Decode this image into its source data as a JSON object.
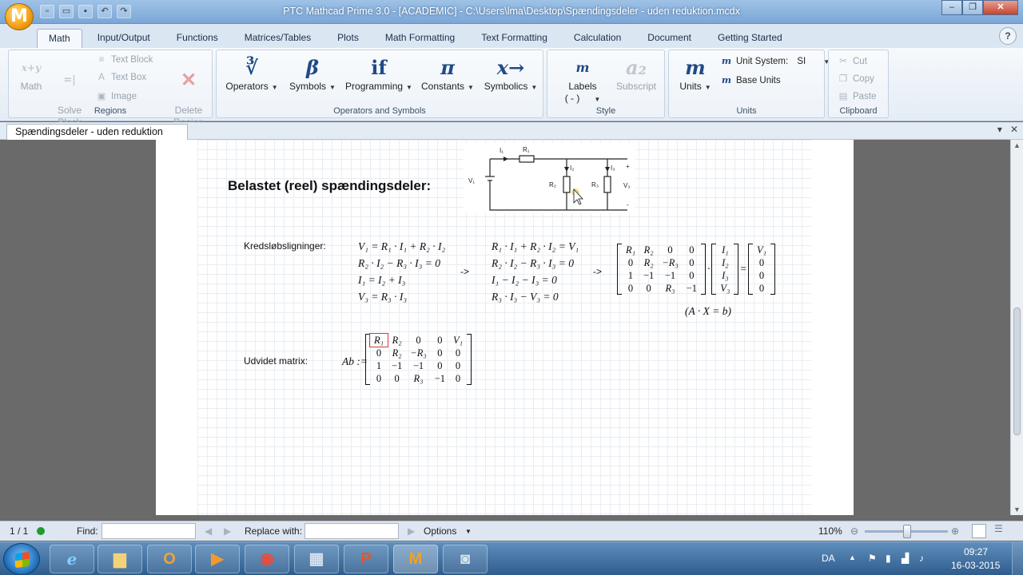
{
  "window": {
    "title": "PTC Mathcad Prime 3.0 - [ACADEMIC] - C:\\Users\\lma\\Desktop\\Spændingsdeler - uden reduktion.mcdx",
    "logo_letter": "M"
  },
  "ribbon_tabs": [
    "Math",
    "Input/Output",
    "Functions",
    "Matrices/Tables",
    "Plots",
    "Math Formatting",
    "Text Formatting",
    "Calculation",
    "Document",
    "Getting Started"
  ],
  "help": "?",
  "ribbon": {
    "regions": {
      "label": "Regions",
      "math": "Math",
      "solve_block": "Solve\nBlock",
      "text_block": "Text Block",
      "text_box": "Text Box",
      "image": "Image",
      "delete_region": "Delete\nRegion",
      "math_glyph": "x+y",
      "solve_glyph": "=|"
    },
    "operators_symbols": {
      "label": "Operators and Symbols",
      "operators": "Operators",
      "operators_glyph": "∛",
      "symbols": "Symbols",
      "symbols_glyph": "β",
      "programming": "Programming",
      "programming_glyph": "if",
      "constants": "Constants",
      "constants_glyph": "π",
      "symbolics": "Symbolics",
      "symbolics_glyph": "x→"
    },
    "style": {
      "label": "Style",
      "labels": "Labels",
      "labels_value": "( - )",
      "labels_glyph": "m",
      "subscript": "Subscript",
      "subscript_glyph": "a₂"
    },
    "units": {
      "label": "Units",
      "units": "Units",
      "units_glyph": "m",
      "unit_system_label": "Unit System:",
      "unit_system_value": "SI",
      "base_units": "Base Units"
    },
    "clipboard": {
      "label": "Clipboard",
      "cut": "Cut",
      "copy": "Copy",
      "paste": "Paste"
    }
  },
  "document_tab": "Spændingsdeler - uden reduktion",
  "worksheet": {
    "heading": "Belastet (reel) spændingsdeler:",
    "circuit_labels": {
      "I1": "I₁",
      "R1": "R₁",
      "I2": "I₂",
      "I3": "I₃",
      "R2": "R₂",
      "R3": "R₃",
      "V1": "V₁",
      "V3": "V₃",
      "plus": "+",
      "minus": "-"
    },
    "kreds_label": "Kredsløbsligninger:",
    "equations_1": [
      "V₁ = R₁ · I₁ + R₂ · I₂",
      "R₂ · I₂ − R₃ · I₃ = 0",
      "I₁ = I₂ + I₃",
      "V₃ = R₃ · I₃"
    ],
    "arrow1": "->",
    "equations_2": [
      "R₁ · I₁ + R₂ · I₂ = V₁",
      "R₂ · I₂ − R₃ · I₃ = 0",
      "I₁ − I₂ − I₃ = 0",
      "R₃ · I₃ − V₃ = 0"
    ],
    "arrow2": "->",
    "matrix_A": [
      [
        "R₁",
        "R₂",
        "0",
        "0"
      ],
      [
        "0",
        "R₂",
        "−R₃",
        "0"
      ],
      [
        "1",
        "−1",
        "−1",
        "0"
      ],
      [
        "0",
        "0",
        "R₃",
        "−1"
      ]
    ],
    "vector_X": [
      "I₁",
      "I₂",
      "I₃",
      "V₃"
    ],
    "vector_b": [
      "V₁",
      "0",
      "0",
      "0"
    ],
    "dot": "·",
    "equals": "=",
    "axb": "(A · X = b)",
    "udvidet_label": "Udvidet matrix:",
    "ab_lhs": "Ab :=",
    "matrix_Ab": [
      [
        "R₁",
        "R₂",
        "0",
        "0",
        "V₁"
      ],
      [
        "0",
        "R₂",
        "−R₃",
        "0",
        "0"
      ],
      [
        "1",
        "−1",
        "−1",
        "0",
        "0"
      ],
      [
        "0",
        "0",
        "R₃",
        "−1",
        "0"
      ]
    ]
  },
  "statusbar": {
    "page": "1 / 1",
    "find_label": "Find:",
    "replace_label": "Replace with:",
    "options": "Options",
    "zoom": "110%",
    "zoom_percent": 110
  },
  "taskbar": {
    "language": "DA",
    "time": "09:27",
    "date": "16-03-2015"
  }
}
